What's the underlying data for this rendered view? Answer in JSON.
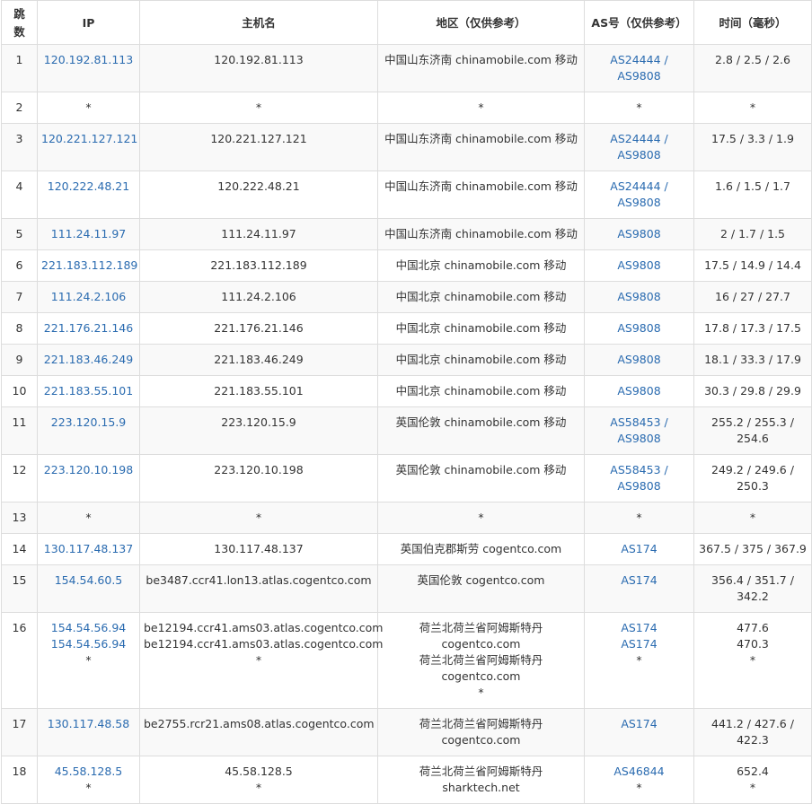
{
  "headers": {
    "hop": "跳数",
    "ip": "IP",
    "host": "主机名",
    "region": "地区（仅供参考）",
    "as": "AS号（仅供参考）",
    "time": "时间（毫秒）"
  },
  "rows": [
    {
      "hop": "1",
      "ip": [
        "120.192.81.113"
      ],
      "host": [
        "120.192.81.113"
      ],
      "region": [
        "中国山东济南 chinamobile.com 移动"
      ],
      "as": [
        "AS24444 /",
        "AS9808"
      ],
      "time": [
        "2.8 / 2.5 / 2.6"
      ]
    },
    {
      "hop": "2",
      "ip": [
        "*"
      ],
      "host": [
        "*"
      ],
      "region": [
        "*"
      ],
      "as": [
        "*"
      ],
      "time": [
        "*"
      ]
    },
    {
      "hop": "3",
      "ip": [
        "120.221.127.121"
      ],
      "host": [
        "120.221.127.121"
      ],
      "region": [
        "中国山东济南 chinamobile.com 移动"
      ],
      "as": [
        "AS24444 /",
        "AS9808"
      ],
      "time": [
        "17.5 / 3.3 / 1.9"
      ]
    },
    {
      "hop": "4",
      "ip": [
        "120.222.48.21"
      ],
      "host": [
        "120.222.48.21"
      ],
      "region": [
        "中国山东济南 chinamobile.com 移动"
      ],
      "as": [
        "AS24444 /",
        "AS9808"
      ],
      "time": [
        "1.6 / 1.5 / 1.7"
      ]
    },
    {
      "hop": "5",
      "ip": [
        "111.24.11.97"
      ],
      "host": [
        "111.24.11.97"
      ],
      "region": [
        "中国山东济南 chinamobile.com 移动"
      ],
      "as": [
        "AS9808"
      ],
      "time": [
        "2 / 1.7 / 1.5"
      ]
    },
    {
      "hop": "6",
      "ip": [
        "221.183.112.189"
      ],
      "host": [
        "221.183.112.189"
      ],
      "region": [
        "中国北京 chinamobile.com 移动"
      ],
      "as": [
        "AS9808"
      ],
      "time": [
        "17.5 / 14.9 / 14.4"
      ]
    },
    {
      "hop": "7",
      "ip": [
        "111.24.2.106"
      ],
      "host": [
        "111.24.2.106"
      ],
      "region": [
        "中国北京 chinamobile.com 移动"
      ],
      "as": [
        "AS9808"
      ],
      "time": [
        "16 / 27 / 27.7"
      ]
    },
    {
      "hop": "8",
      "ip": [
        "221.176.21.146"
      ],
      "host": [
        "221.176.21.146"
      ],
      "region": [
        "中国北京 chinamobile.com 移动"
      ],
      "as": [
        "AS9808"
      ],
      "time": [
        "17.8 / 17.3 / 17.5"
      ]
    },
    {
      "hop": "9",
      "ip": [
        "221.183.46.249"
      ],
      "host": [
        "221.183.46.249"
      ],
      "region": [
        "中国北京 chinamobile.com 移动"
      ],
      "as": [
        "AS9808"
      ],
      "time": [
        "18.1 / 33.3 / 17.9"
      ]
    },
    {
      "hop": "10",
      "ip": [
        "221.183.55.101"
      ],
      "host": [
        "221.183.55.101"
      ],
      "region": [
        "中国北京 chinamobile.com 移动"
      ],
      "as": [
        "AS9808"
      ],
      "time": [
        "30.3 / 29.8 / 29.9"
      ]
    },
    {
      "hop": "11",
      "ip": [
        "223.120.15.9"
      ],
      "host": [
        "223.120.15.9"
      ],
      "region": [
        "英国伦敦 chinamobile.com 移动"
      ],
      "as": [
        "AS58453 /",
        "AS9808"
      ],
      "time": [
        "255.2 / 255.3 /",
        "254.6"
      ]
    },
    {
      "hop": "12",
      "ip": [
        "223.120.10.198"
      ],
      "host": [
        "223.120.10.198"
      ],
      "region": [
        "英国伦敦 chinamobile.com 移动"
      ],
      "as": [
        "AS58453 /",
        "AS9808"
      ],
      "time": [
        "249.2 / 249.6 /",
        "250.3"
      ]
    },
    {
      "hop": "13",
      "ip": [
        "*"
      ],
      "host": [
        "*"
      ],
      "region": [
        "*"
      ],
      "as": [
        "*"
      ],
      "time": [
        "*"
      ]
    },
    {
      "hop": "14",
      "ip": [
        "130.117.48.137"
      ],
      "host": [
        "130.117.48.137"
      ],
      "region": [
        "英国伯克郡斯劳 cogentco.com"
      ],
      "as": [
        "AS174"
      ],
      "time": [
        "367.5 / 375 / 367.9"
      ]
    },
    {
      "hop": "15",
      "ip": [
        "154.54.60.5"
      ],
      "host": [
        "be3487.ccr41.lon13.atlas.cogentco.com"
      ],
      "region": [
        "英国伦敦 cogentco.com"
      ],
      "as": [
        "AS174"
      ],
      "time": [
        "356.4 / 351.7 /",
        "342.2"
      ]
    },
    {
      "hop": "16",
      "ip": [
        "154.54.56.94",
        "154.54.56.94",
        "*"
      ],
      "host": [
        "be12194.ccr41.ams03.atlas.cogentco.com",
        "be12194.ccr41.ams03.atlas.cogentco.com",
        "*"
      ],
      "region": [
        "荷兰北荷兰省阿姆斯特丹",
        "cogentco.com",
        "荷兰北荷兰省阿姆斯特丹",
        "cogentco.com",
        "*"
      ],
      "as": [
        "AS174",
        "AS174",
        "*"
      ],
      "time": [
        "477.6",
        "470.3",
        "*"
      ]
    },
    {
      "hop": "17",
      "ip": [
        "130.117.48.58"
      ],
      "host": [
        "be2755.rcr21.ams08.atlas.cogentco.com"
      ],
      "region": [
        "荷兰北荷兰省阿姆斯特丹",
        "cogentco.com"
      ],
      "as": [
        "AS174"
      ],
      "time": [
        "441.2 / 427.6 /",
        "422.3"
      ]
    },
    {
      "hop": "18",
      "ip": [
        "45.58.128.5",
        "*"
      ],
      "host": [
        "45.58.128.5",
        "*"
      ],
      "region": [
        "荷兰北荷兰省阿姆斯特丹",
        "sharktech.net"
      ],
      "as": [
        "AS46844",
        "*"
      ],
      "time": [
        "652.4",
        "*"
      ]
    }
  ]
}
